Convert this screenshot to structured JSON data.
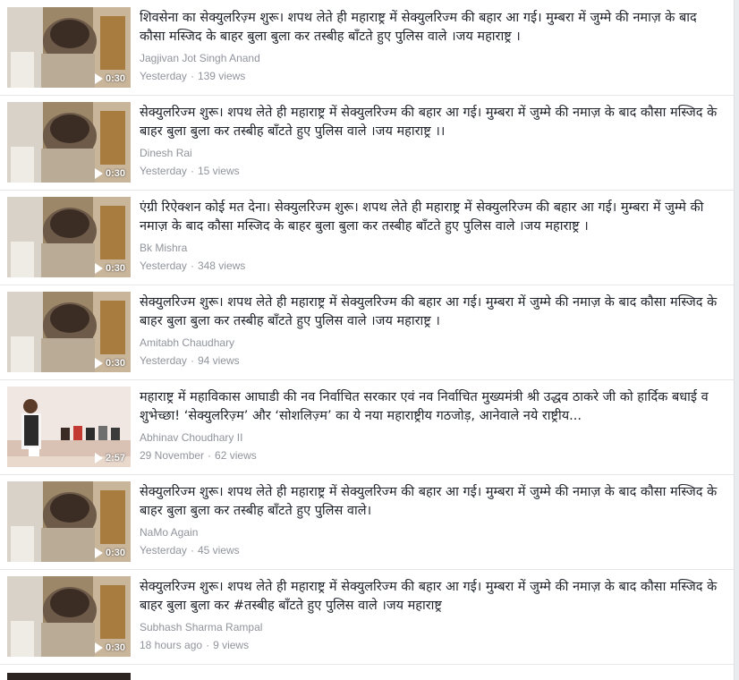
{
  "videos": [
    {
      "title": "शिवसेना का सेक्युलरिज़्म शुरू। शपथ लेते ही महाराष्ट्र में सेक्युलरिज्म की बहार आ गई। मुम्बरा में जुम्मे की नमाज़ के बाद कौसा मस्जिद के बाहर बुला बुला कर तस्बीह बाँटते हुए पुलिस वाले ।जय महाराष्ट्र ।",
      "author": "Jagjivan Jot Singh Anand",
      "time": "Yesterday",
      "views": "139 views",
      "duration": "0:30"
    },
    {
      "title": "सेक्युलरिज्म शुरू। शपथ लेते ही महाराष्ट्र में सेक्युलरिज्म की बहार आ गई। मुम्बरा में जुम्मे की नमाज़ के बाद कौसा मस्जिद के बाहर बुला बुला कर तस्बीह बाँटते हुए पुलिस वाले ।जय महाराष्ट्र ।।",
      "author": "Dinesh Rai",
      "time": "Yesterday",
      "views": "15 views",
      "duration": "0:30"
    },
    {
      "title": "एंग्री रिऐक्शन कोई मत देना। सेक्युलरिज्म शुरू। शपथ लेते ही महाराष्ट्र में सेक्युलरिज्म की बहार आ गई। मुम्बरा में जुम्मे की नमाज़ के बाद कौसा मस्जिद के बाहर बुला बुला कर तस्बीह बाँटते हुए पुलिस वाले ।जय महाराष्ट्र ।",
      "author": "Bk Mishra",
      "time": "Yesterday",
      "views": "348 views",
      "duration": "0:30"
    },
    {
      "title": "सेक्युलरिज्म शुरू। शपथ लेते ही महाराष्ट्र में सेक्युलरिज्म की बहार आ गई। मुम्बरा में जुम्मे की नमाज़ के बाद कौसा मस्जिद के बाहर बुला बुला कर तस्बीह बाँटते हुए पुलिस वाले ।जय महाराष्ट्र ।",
      "author": "Amitabh Chaudhary",
      "time": "Yesterday",
      "views": "94 views",
      "duration": "0:30"
    },
    {
      "title": "महाराष्ट्र में महाविकास आघाडी की नव निर्वाचित सरकार एवं नव निर्वाचित मुख्यमंत्री श्री उद्धव ठाकरे जी को हार्दिक बधाई व शुभेच्छा! ‘सेक्युलरिज़्म’ और ‘सोशलिज़्म’ का ये नया महाराष्ट्रीय गठजोड़, आनेवाले नये राष्ट्रीय...",
      "author": "Abhinav Choudhary II",
      "time": "29 November",
      "views": "62 views",
      "duration": "2:57"
    },
    {
      "title": "सेक्युलरिज्म शुरू। शपथ लेते ही महाराष्ट्र में सेक्युलरिज्म की बहार आ गई। मुम्बरा में जुम्मे की नमाज़ के बाद कौसा मस्जिद के बाहर बुला बुला कर तस्बीह बाँटते हुए पुलिस वाले।",
      "author": "NaMo Again",
      "time": "Yesterday",
      "views": "45 views",
      "duration": "0:30"
    },
    {
      "title": "सेक्युलरिज्म शुरू। शपथ लेते ही महाराष्ट्र में सेक्युलरिज्म की बहार आ गई। मुम्बरा में जुम्मे की नमाज़ के बाद कौसा मस्जिद के बाहर बुला बुला कर #तस्बीह बाँटते हुए पुलिस वाले ।जय महाराष्ट्र",
      "author": "Subhash Sharma Rampal",
      "time": "18 hours ago",
      "views": "9 views",
      "duration": "0:30"
    }
  ],
  "separator": "·",
  "colors": {
    "meta": "#90949c",
    "title": "#1d2129",
    "divider": "#e5e6e9"
  }
}
